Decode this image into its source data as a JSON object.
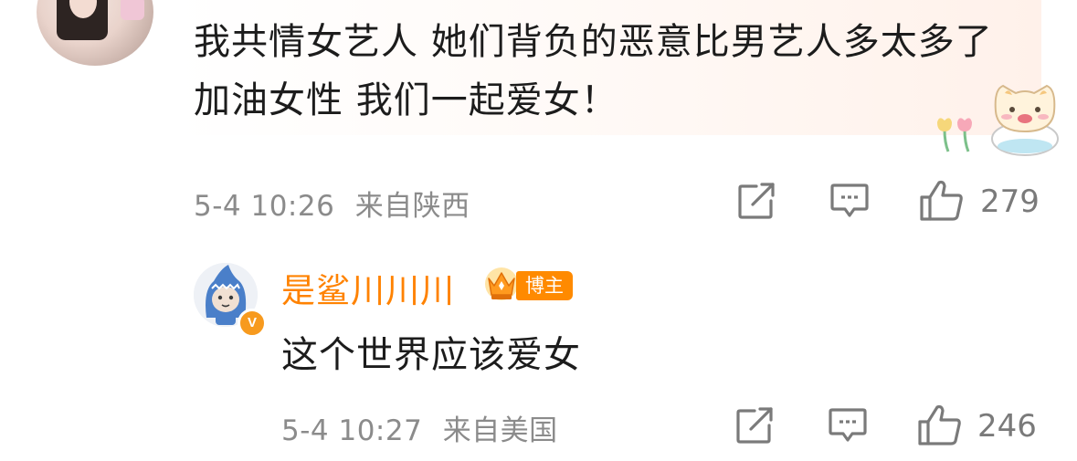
{
  "comment": {
    "text": "我共情女艺人 她们背负的恶意比男艺人多太多了 加油女性 我们一起爱女！",
    "time": "5-4 10:26",
    "location": "来自陕西",
    "likes": "279"
  },
  "reply": {
    "username": "是鲨川川川",
    "badge": "博主",
    "verified_mark": "V",
    "text": "这个世界应该爱女",
    "time": "5-4 10:27",
    "location": "来自美国",
    "likes": "246"
  },
  "colors": {
    "accent": "#ff8200",
    "meta_text": "#8b8b8b",
    "icon": "#7a7a7a"
  }
}
